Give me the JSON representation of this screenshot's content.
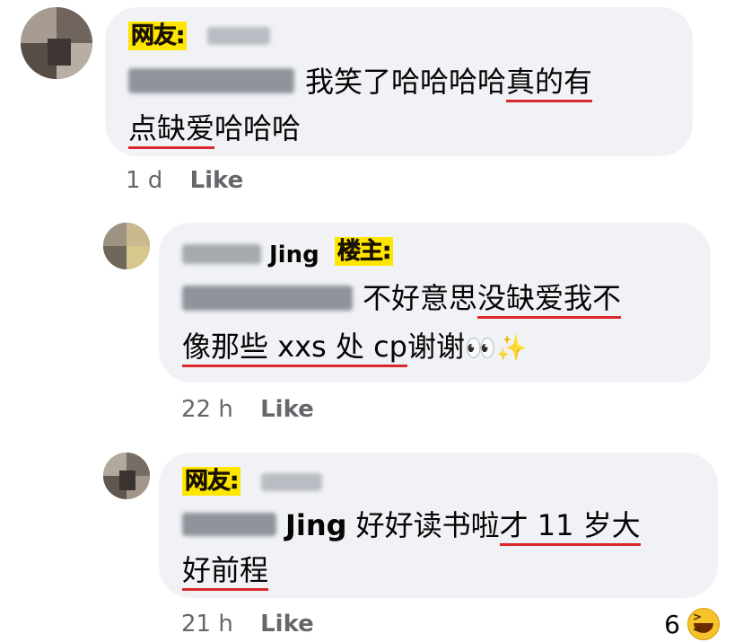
{
  "colors": {
    "bubble": "#f0f2f5",
    "tag": "#ffe600",
    "underline": "#d8282b",
    "meta": "#65676b"
  },
  "comments": [
    {
      "tag": "网友:",
      "line1_plain": "我笑了哈哈哈哈",
      "line1_u": "真的有",
      "line2_u": "点缺爱",
      "line2_plain": "哈哈哈",
      "time": "1 d",
      "like": "Like"
    },
    {
      "name_tail": "Jing",
      "tag": "楼主:",
      "line1_plain": "不好意思",
      "line1_u": "没缺爱我不",
      "line2_u": "像那些 xxs 处 cp",
      "line2_plain": "谢谢",
      "line2_emoji1": "👀",
      "line2_emoji2": "✨",
      "time": "22 h",
      "like": "Like"
    },
    {
      "tag": "网友:",
      "mention_tail": "Jing",
      "line1_plain": "好好读书啦",
      "line1_u": "才 11 岁大",
      "line2_u": "好前程",
      "time": "21 h",
      "like": "Like",
      "reaction_count": "6",
      "reaction_icon": "laughing-emoji-icon"
    }
  ]
}
